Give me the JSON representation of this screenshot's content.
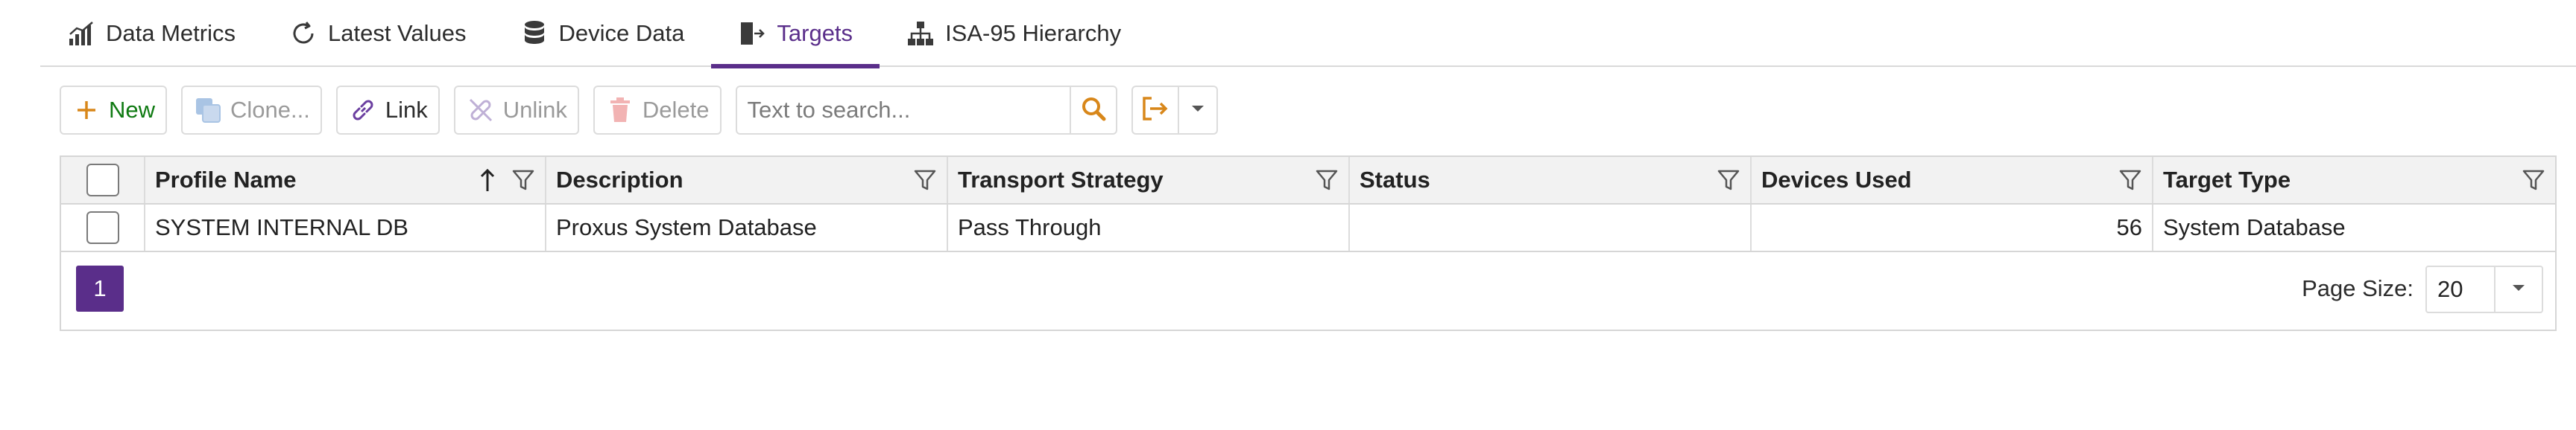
{
  "tabs": [
    {
      "label": "Data Metrics",
      "icon": "bar-chart-icon"
    },
    {
      "label": "Latest Values",
      "icon": "refresh-icon"
    },
    {
      "label": "Device Data",
      "icon": "database-icon"
    },
    {
      "label": "Targets",
      "icon": "export-icon",
      "active": true
    },
    {
      "label": "ISA-95 Hierarchy",
      "icon": "hierarchy-icon"
    }
  ],
  "toolbar": {
    "new_label": "New",
    "clone_label": "Clone...",
    "link_label": "Link",
    "unlink_label": "Unlink",
    "delete_label": "Delete",
    "search_placeholder": "Text to search..."
  },
  "grid": {
    "columns": [
      "Profile Name",
      "Description",
      "Transport Strategy",
      "Status",
      "Devices Used",
      "Target Type"
    ],
    "sorted_column": "Profile Name",
    "sort_direction": "ascending",
    "rows": [
      {
        "profile_name": "SYSTEM INTERNAL DB",
        "description": "Proxus System Database",
        "transport_strategy": "Pass Through",
        "status": "",
        "devices_used": "56",
        "target_type": "System Database"
      }
    ]
  },
  "pager": {
    "current_page": "1",
    "page_size_label": "Page Size:",
    "page_size": "20"
  },
  "colors": {
    "accent": "#5a2e8a",
    "new_green": "#0f7a12",
    "search_orange": "#d8871a"
  }
}
